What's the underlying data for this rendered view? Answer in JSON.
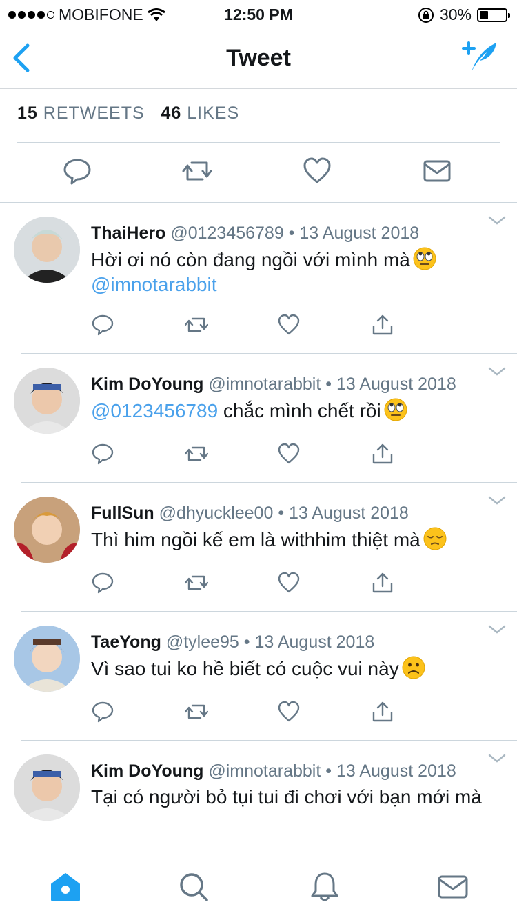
{
  "status_bar": {
    "carrier": "MOBIFONE",
    "time": "12:50 PM",
    "battery": "30%"
  },
  "header": {
    "title": "Tweet",
    "back_icon": "chevron-left-icon",
    "compose_icon": "compose-tweet-icon",
    "accent": "#1da1f2"
  },
  "stats": {
    "retweets_count": "15",
    "retweets_label": "RETWEETS",
    "likes_count": "46",
    "likes_label": "LIKES"
  },
  "replies": [
    {
      "name": "ThaiHero",
      "handle": "@0123456789",
      "date": "13 August 2018",
      "text_1": "Hời ơi nó còn đang ngồi với mình mà",
      "emoji": "face-with-rolling-eyes",
      "mention": "@imnotarabbit"
    },
    {
      "name": "Kim DoYoung",
      "handle": "@imnotarabbit",
      "date": "13 August 2018",
      "mention": "@0123456789",
      "text_1": " chắc mình chết rồi",
      "emoji": "face-with-rolling-eyes"
    },
    {
      "name": "FullSun",
      "handle": "@dhyucklee00",
      "date": "13 August 2018",
      "text_1": "Thì him ngồi kế em là withhim thiệt mà",
      "emoji": "pensive-face"
    },
    {
      "name": "TaeYong",
      "handle": "@tylee95",
      "date": "13 August 2018",
      "text_1": "Vì sao tui ko hề biết có cuộc vui này",
      "emoji": "frowning-face"
    },
    {
      "name": "Kim DoYoung",
      "handle": "@imnotarabbit",
      "date": "13 August 2018",
      "text_1": "Tại có người bỏ tụi tui đi chơi với bạn mới mà"
    }
  ],
  "tabbar": {
    "items": [
      "home-icon",
      "search-icon",
      "notifications-icon",
      "messages-icon"
    ],
    "active": "home-icon"
  }
}
